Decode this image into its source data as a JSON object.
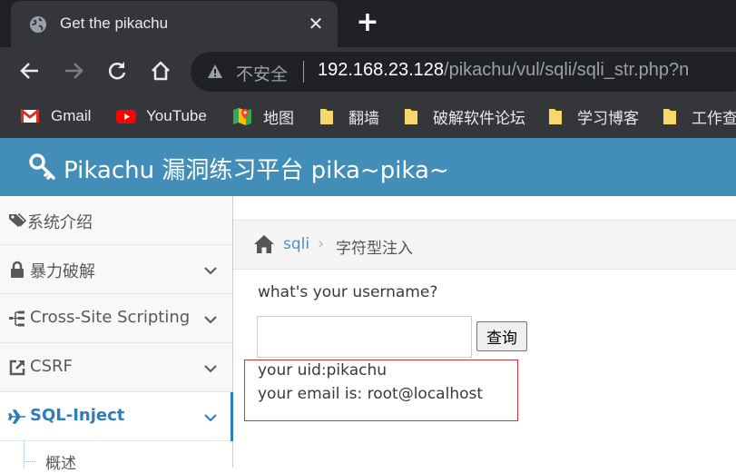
{
  "browser": {
    "tab": {
      "title": "Get the pikachu",
      "close": "✕",
      "globe_icon": "globe-icon"
    },
    "new_tab": "+",
    "omnibox": {
      "security_label": "不安全",
      "url_host": "192.168.23.128",
      "url_path": "/pikachu/vul/sqli/sqli_str.php?n"
    },
    "bookmarks": [
      {
        "label": "Gmail",
        "icon": "gmail-icon"
      },
      {
        "label": "YouTube",
        "icon": "youtube-icon"
      },
      {
        "label": "地图",
        "icon": "maps-icon"
      },
      {
        "label": "翻墙",
        "icon": "folder-icon"
      },
      {
        "label": "破解软件论坛",
        "icon": "folder-icon"
      },
      {
        "label": "学习博客",
        "icon": "folder-icon"
      },
      {
        "label": "工作查",
        "icon": "folder-icon"
      }
    ]
  },
  "header": {
    "title": "Pikachu 漏洞练习平台 pika~pika~",
    "icon": "key-icon"
  },
  "sidebar": {
    "items": [
      {
        "label": "系统介绍",
        "icon": "tags-icon",
        "expandable": false
      },
      {
        "label": "暴力破解",
        "icon": "lock-icon",
        "expandable": true
      },
      {
        "label": "Cross-Site Scripting",
        "icon": "sitemap-icon",
        "expandable": true
      },
      {
        "label": "CSRF",
        "icon": "share-icon",
        "expandable": true
      },
      {
        "label": "SQL-Inject",
        "icon": "plane-icon",
        "expandable": true,
        "active": true
      }
    ],
    "subitems": [
      {
        "label": "概述"
      }
    ]
  },
  "breadcrumb": {
    "link": "sqli",
    "separator": "›",
    "current": "字符型注入"
  },
  "form": {
    "question": "what's your username?",
    "input_value": "",
    "submit_label": "查询"
  },
  "result": {
    "uid_line": "your uid:pikachu",
    "email_line": "your email is: root@localhost"
  },
  "colors": {
    "header_bg": "#438eb9",
    "active_link": "#2b7dbc",
    "highlight_border": "#d0343b",
    "chrome_dark": "#202124",
    "chrome_toolbar": "#35363a"
  }
}
